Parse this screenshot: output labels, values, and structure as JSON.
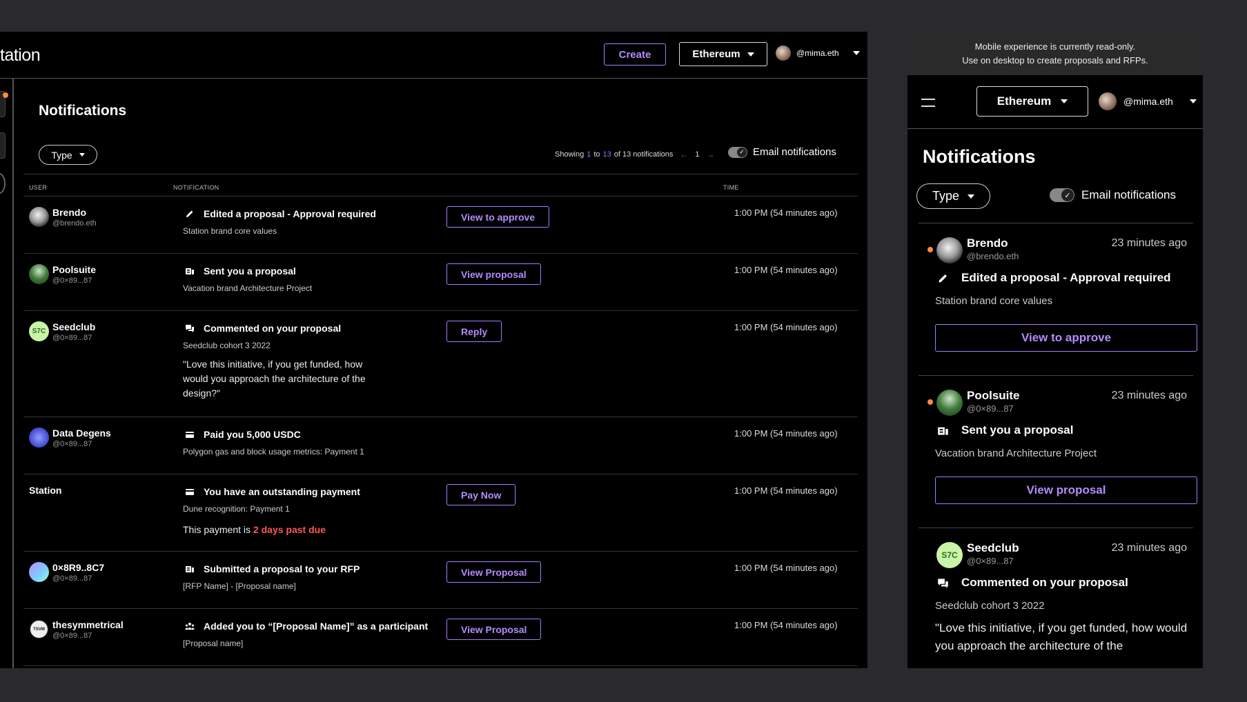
{
  "app": {
    "brand_fragment": "tation",
    "create_label": "Create",
    "chain_label": "Ethereum",
    "user_handle": "@mima.eth"
  },
  "page": {
    "title": "Notifications",
    "type_filter": "Type",
    "pager": {
      "showing": "Showing",
      "from": "1",
      "to_word": "to",
      "to": "13",
      "of_text": "of 13 notifications",
      "page": "1"
    },
    "email_toggle_label": "Email notifications",
    "email_toggle_on": true
  },
  "table": {
    "columns": {
      "user": "USER",
      "notification": "NOTIFICATION",
      "time": "TIME"
    },
    "rows": [
      {
        "unread": true,
        "user_name": "Brendo",
        "user_handle": "@brendo.eth",
        "icon": "pencil-icon",
        "title": "Edited a proposal - Approval required",
        "subtitle": "Station brand core values",
        "action": "View to approve",
        "time": "1:00 PM (54 minutes ago)"
      },
      {
        "unread": true,
        "user_name": "Poolsuite",
        "user_handle": "@0×89...87",
        "icon": "proposal-icon",
        "title": "Sent you a proposal",
        "subtitle": "Vacation brand Architecture Project",
        "action": "View proposal",
        "time": "1:00 PM (54 minutes ago)"
      },
      {
        "unread": false,
        "user_name": "Seedclub",
        "user_handle": "@0×89...87",
        "avatar_text": "S7C",
        "icon": "comment-icon",
        "title": "Commented on your proposal",
        "subtitle": "Seedclub cohort 3 2022",
        "quote": "\"Love this initiative, if you get funded, how would you approach the architecture of the design?\"",
        "action": "Reply",
        "time": "1:00 PM (54 minutes ago)"
      },
      {
        "unread": false,
        "user_name": "Data Degens",
        "user_handle": "@0×89...87",
        "icon": "payment-icon",
        "title": "Paid you 5,000 USDC",
        "subtitle": "Polygon gas and block usage metrics: Payment 1",
        "time": "1:00 PM (54 minutes ago)"
      },
      {
        "unread": false,
        "user_name": "Station",
        "icon": "payment-icon",
        "title": "You have an outstanding payment",
        "subtitle": "Dune recognition: Payment 1",
        "due_prefix": "This payment is",
        "due_text": "2 days past due",
        "action": "Pay Now",
        "time": "1:00 PM (54 minutes ago)"
      },
      {
        "unread": false,
        "user_name": "0×8R9..8C7",
        "user_handle": "@0×89...87",
        "icon": "proposal-icon",
        "title": "Submitted a proposal to your RFP",
        "subtitle": "[RFP Name] - [Proposal name]",
        "action": "View Proposal",
        "time": "1:00 PM (54 minutes ago)"
      },
      {
        "unread": false,
        "user_name": "thesymmetrical",
        "user_handle": "@0×89...87",
        "avatar_text": "TSVM",
        "icon": "participants-icon",
        "title": "Added you to “[Proposal Name]” as a participant",
        "subtitle": "[Proposal name]",
        "action": "View Proposal",
        "time": "1:00 PM (54 minutes ago)"
      }
    ]
  },
  "mobile": {
    "banner_line1": "Mobile experience is currently read-only.",
    "banner_line2": "Use on desktop to create proposals and RFPs.",
    "chain_label": "Ethereum",
    "user_handle": "@mima.eth",
    "title": "Notifications",
    "type_filter": "Type",
    "email_toggle_label": "Email notifications",
    "cards": [
      {
        "unread": true,
        "user_name": "Brendo",
        "user_handle": "@brendo.eth",
        "time": "23 minutes ago",
        "icon": "pencil-icon",
        "title": "Edited a proposal - Approval required",
        "subtitle": "Station brand core values",
        "action": "View to approve"
      },
      {
        "unread": true,
        "user_name": "Poolsuite",
        "user_handle": "@0×89...87",
        "time": "23 minutes ago",
        "icon": "proposal-icon",
        "title": "Sent you a proposal",
        "subtitle": "Vacation brand Architecture Project",
        "action": "View proposal"
      },
      {
        "unread": false,
        "user_name": "Seedclub",
        "user_handle": "@0×89...87",
        "avatar_text": "S7C",
        "time": "23 minutes ago",
        "icon": "comment-icon",
        "title": "Commented on your proposal",
        "subtitle": "Seedclub cohort 3 2022",
        "quote": "\"Love this initiative, if you get funded, how would you approach the architecture of the"
      }
    ]
  },
  "colors": {
    "accent": "#a77dff",
    "unread": "#ff8a3d",
    "due": "#ff5757",
    "background": "#000000",
    "frame": "#2a2a2c"
  }
}
